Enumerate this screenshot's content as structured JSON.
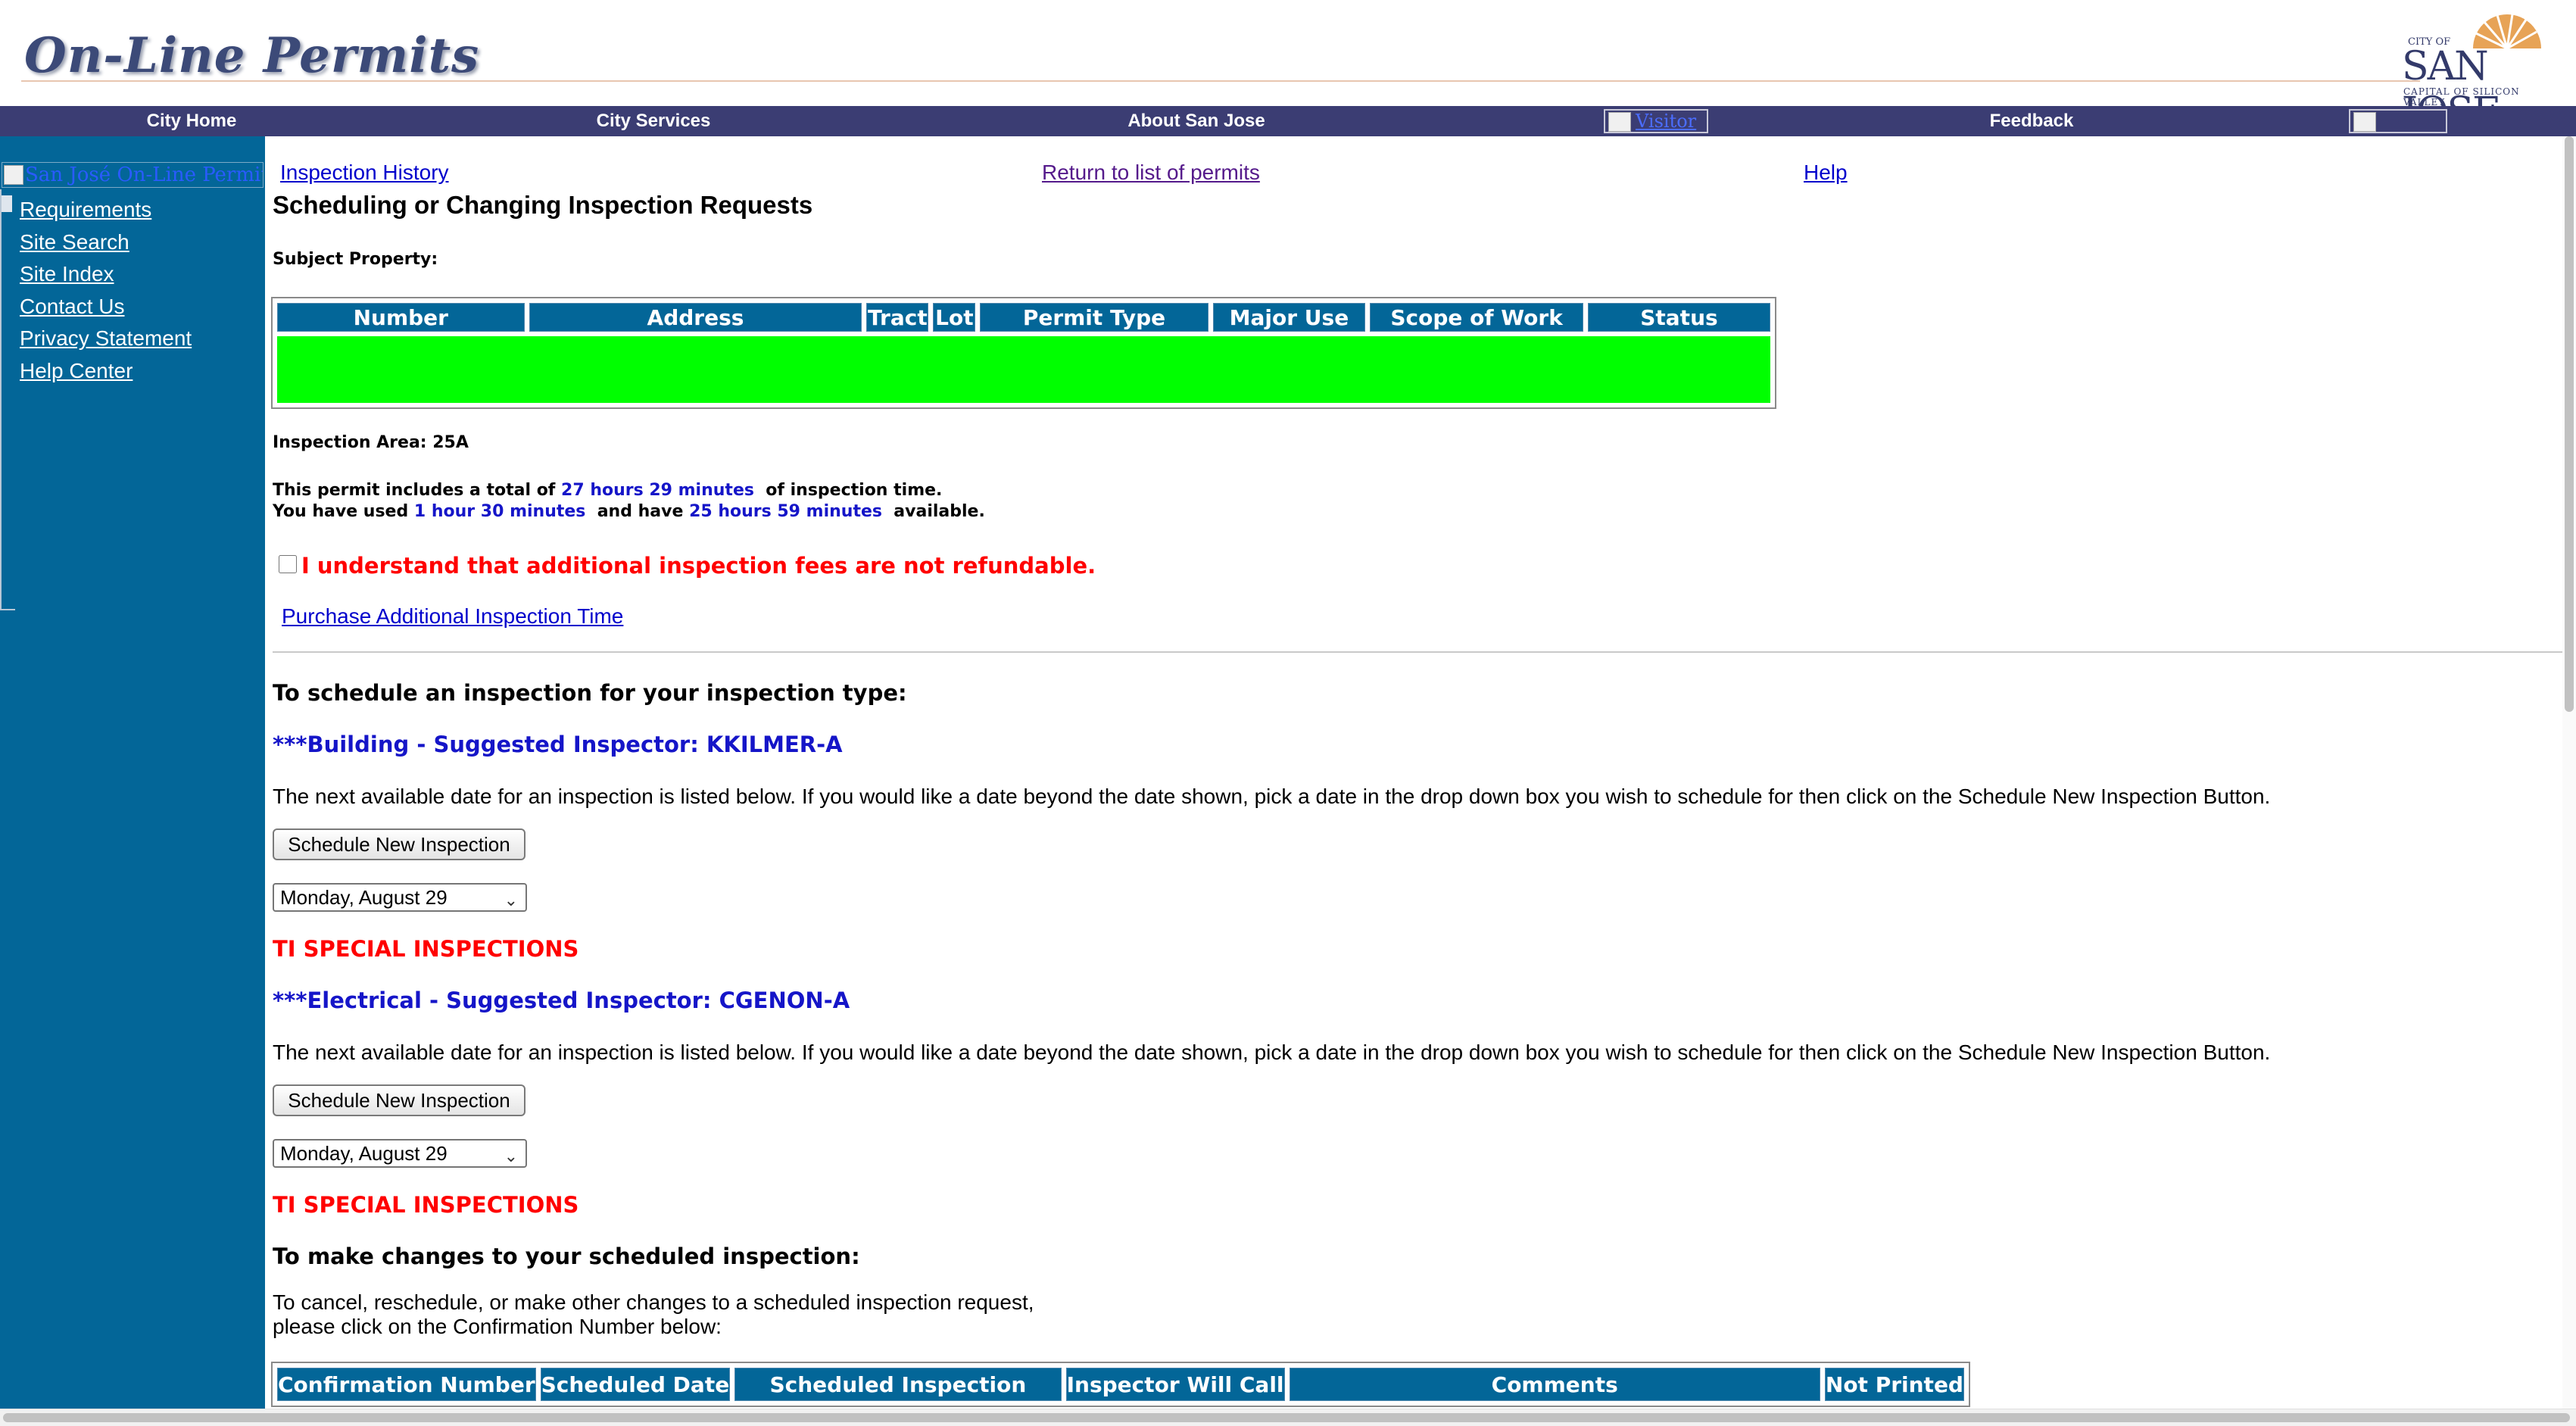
{
  "header": {
    "site_title": "On-Line Permits",
    "logo": {
      "city_of": "CITY OF",
      "name": "SAN JOSE",
      "tagline": "CAPITAL OF SILICON VALLEY"
    }
  },
  "nav": {
    "items": [
      "City Home",
      "City Services",
      "About San Jose",
      "Feedback"
    ],
    "visitor_img_alt": "Visitor"
  },
  "sidebar": {
    "logo_alt": "San José On-Line Permits",
    "links": [
      "Requirements",
      "Site Search",
      "Site Index",
      "Contact Us",
      "Privacy Statement",
      "Help Center"
    ]
  },
  "main": {
    "top_links": {
      "history": "Inspection History",
      "return": "Return to list of permits",
      "help": "Help"
    },
    "title": "Scheduling or Changing Inspection Requests",
    "subject_label": "Subject Property:",
    "subject_table": {
      "headers": [
        "Number",
        "Address",
        "Tract",
        "Lot",
        "Permit Type",
        "Major Use",
        "Scope of Work",
        "Status"
      ]
    },
    "inspection_area": "Inspection Area: 25A",
    "time_info": {
      "line1_pre": "This permit includes a total of ",
      "total": "27 hours 29 minutes",
      "line1_post": "  of inspection time.",
      "line2_pre": "You have used ",
      "used": "1 hour 30 minutes",
      "line2_mid": "  and have ",
      "available": "25 hours 59 minutes",
      "line2_post": "  available."
    },
    "refund_notice": "I understand that additional inspection fees are not refundable.",
    "purchase_link": "Purchase Additional Inspection Time",
    "schedule_heading": "To schedule an inspection for your inspection type:",
    "inspections": [
      {
        "heading": "***Building - Suggested Inspector: KKILMER-A",
        "note": "The next available date for an inspection is listed below. If you would like a date beyond the date shown, pick a date in the drop down box you wish to schedule for then click on the Schedule New Inspection Button.",
        "button": "Schedule New Inspection",
        "date": "Monday, August 29",
        "special": "TI SPECIAL INSPECTIONS"
      },
      {
        "heading": "***Electrical - Suggested Inspector: CGENON-A",
        "note": "The next available date for an inspection is listed below. If you would like a date beyond the date shown, pick a date in the drop down box you wish to schedule for then click on the Schedule New Inspection Button.",
        "button": "Schedule New Inspection",
        "date": "Monday, August 29",
        "special": "TI SPECIAL INSPECTIONS"
      }
    ],
    "changes_heading": "To make changes to your scheduled inspection:",
    "cancel_text_line1": "To cancel, reschedule, or make other changes to a scheduled inspection request,",
    "cancel_text_line2": "please click on the Confirmation Number below:",
    "confirmation_table": {
      "headers": [
        "Confirmation Number",
        "Scheduled Date",
        "Scheduled Inspection",
        "Inspector Will Call",
        "Comments",
        "Not Printed"
      ]
    }
  },
  "colors": {
    "sidebar": "#036698",
    "navbar": "#3b3d73",
    "table_header": "#036698",
    "status_green": "#00ff00",
    "alert_red": "#ff0000",
    "link_blue": "#0000cc"
  }
}
